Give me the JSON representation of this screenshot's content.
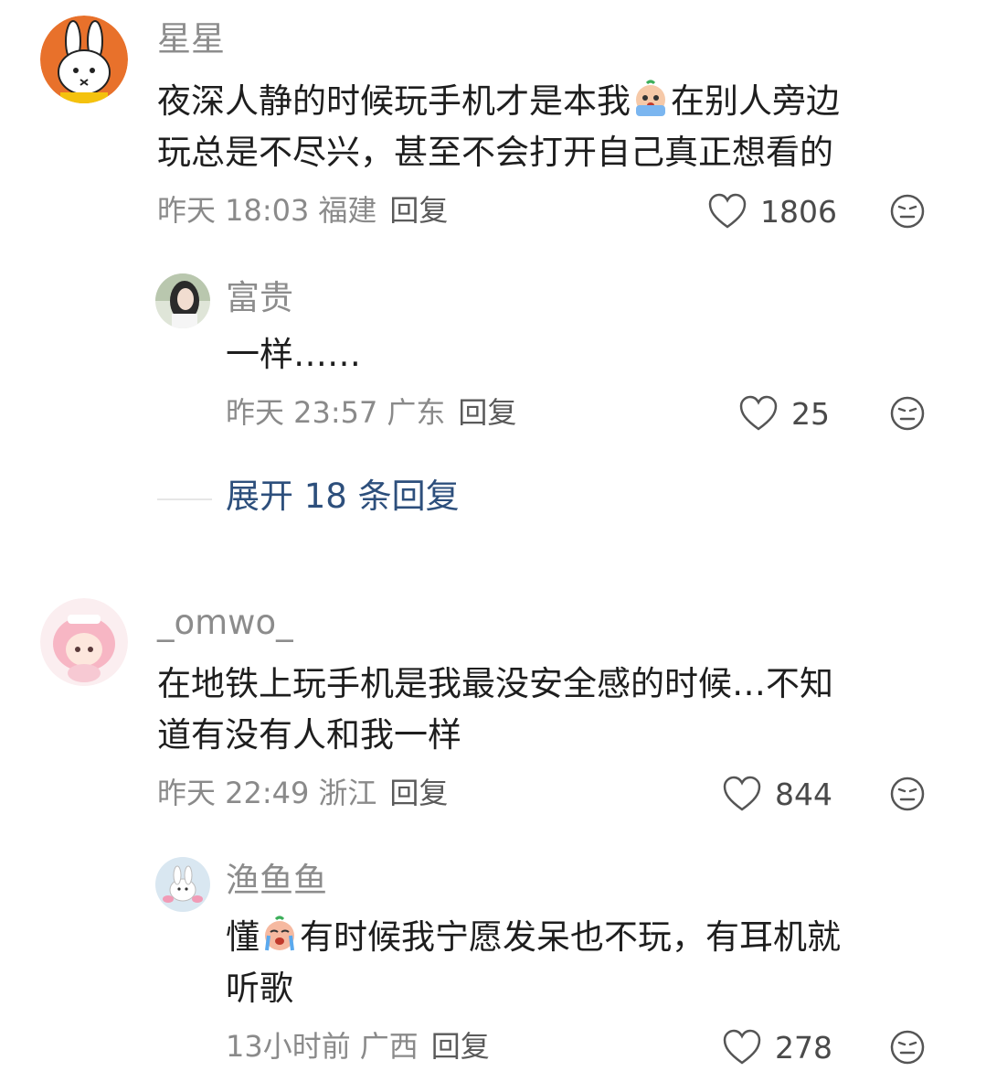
{
  "comments": [
    {
      "username": "星星",
      "text_line1_a": "夜深人静的时候玩手机才是本我",
      "text_line1_b": "在别人旁边",
      "text_line2": "玩总是不尽兴，甚至不会打开自己真正想看的",
      "time": "昨天 18:03",
      "region": "福建",
      "reply_label": "回复",
      "likes": "1806",
      "avatar_icon": "miffy-bunny-avatar",
      "emoji_icon": "crying-emoji"
    },
    {
      "username": "富贵",
      "text_line1": "一样……",
      "time": "昨天 23:57",
      "region": "广东",
      "reply_label": "回复",
      "likes": "25",
      "avatar_icon": "girl-photo-avatar"
    },
    {
      "username": "_omwo_",
      "text_line1": "在地铁上玩手机是我最没安全感的时候…不知",
      "text_line2": "道有没有人和我一样",
      "time": "昨天 22:49",
      "region": "浙江",
      "reply_label": "回复",
      "likes": "844",
      "avatar_icon": "pink-anime-avatar"
    },
    {
      "username": "渔鱼鱼",
      "text_line1_a": "懂",
      "text_line1_b": "有时候我宁愿发呆也不玩，有耳机就",
      "text_line2": "听歌",
      "time": "13小时前",
      "region": "广西",
      "reply_label": "回复",
      "likes": "278",
      "avatar_icon": "bunny-toy-avatar",
      "emoji_icon": "crying-emoji"
    }
  ],
  "expand_replies": "展开 18 条回复",
  "colors": {
    "username": "#8c8c8c",
    "text": "#1e1e1e",
    "meta": "#8a8a8a",
    "expand": "#2d4f7c",
    "avatar_orange": "#e8712b"
  }
}
